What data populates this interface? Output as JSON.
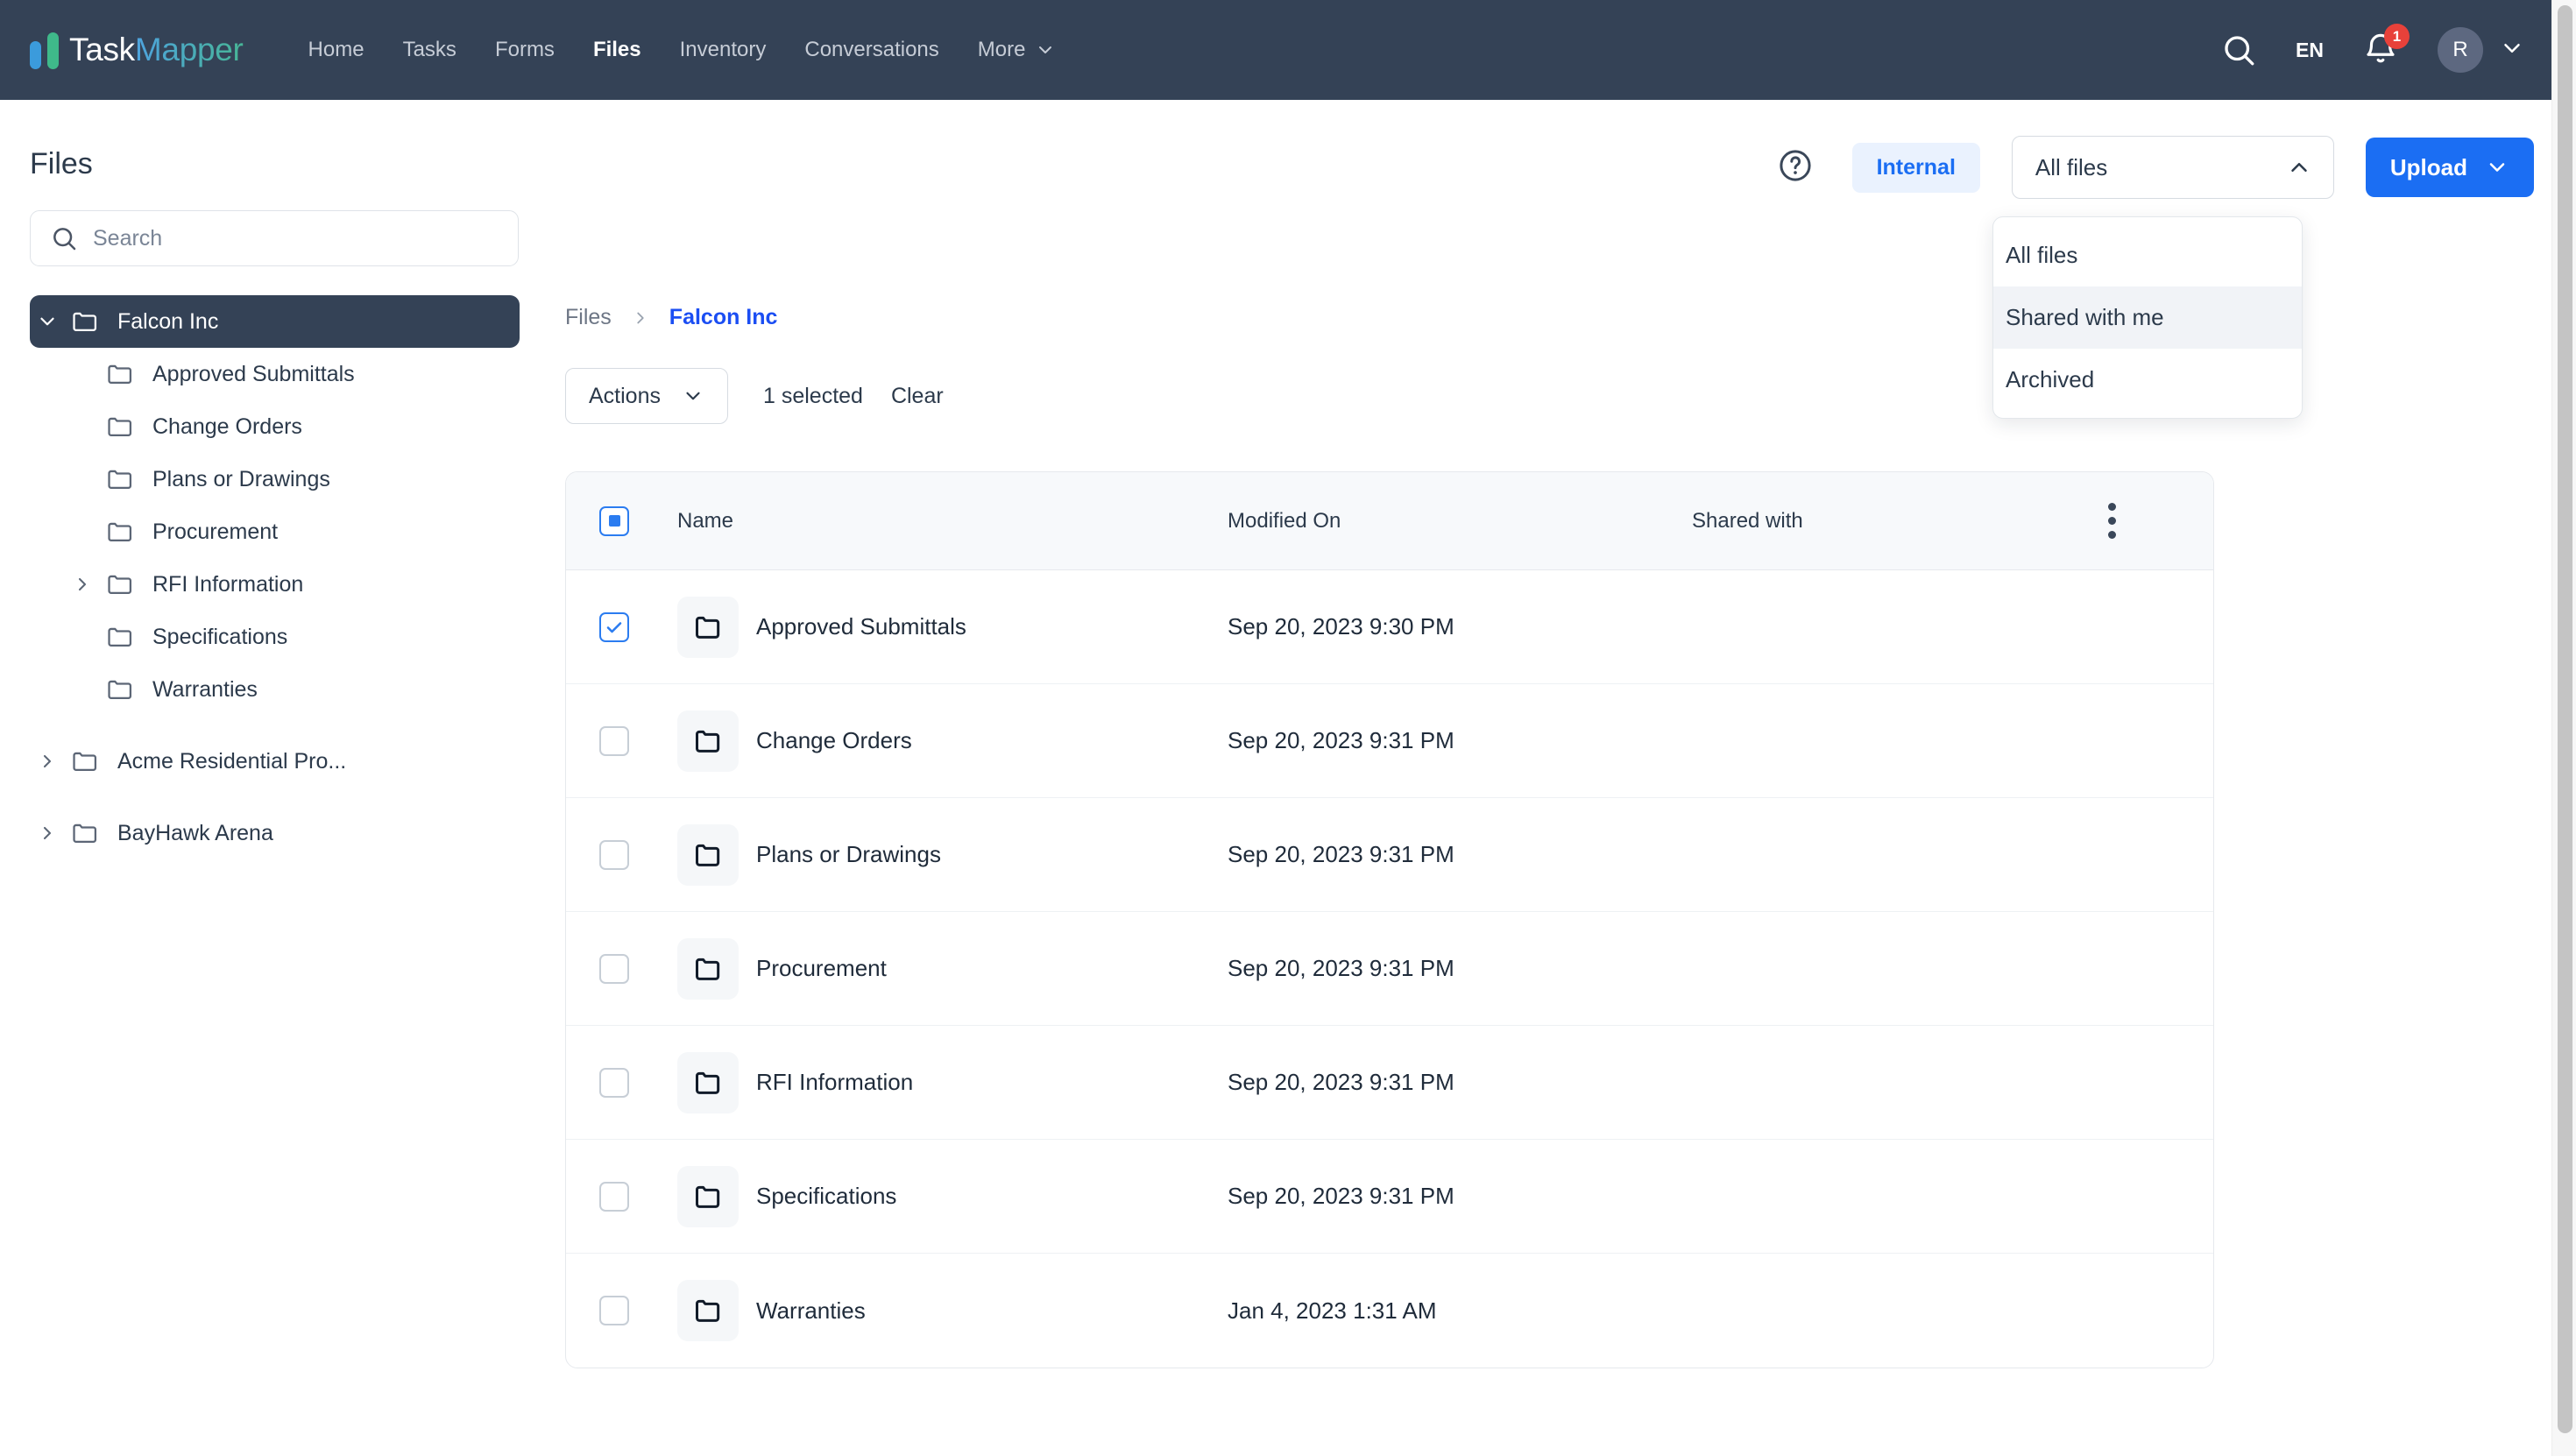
{
  "brand": {
    "name_first": "Task",
    "name_second": "Mapper",
    "bar_blue": "#3b9bdc",
    "bar_green": "#3fb98a"
  },
  "topnav": {
    "links": [
      {
        "label": "Home",
        "active": false
      },
      {
        "label": "Tasks",
        "active": false
      },
      {
        "label": "Forms",
        "active": false
      },
      {
        "label": "Files",
        "active": true
      },
      {
        "label": "Inventory",
        "active": false
      },
      {
        "label": "Conversations",
        "active": false
      }
    ],
    "more_label": "More",
    "search_icon": "search-icon",
    "language": "EN",
    "bell_icon": "bell-icon",
    "notification_count": "1",
    "avatar_initial": "R",
    "caret_icon": "chevron-down-icon"
  },
  "page": {
    "title": "Files"
  },
  "header_actions": {
    "help_icon": "question-circle-icon",
    "internal_chip": "Internal",
    "filter_select": {
      "value": "All files",
      "caret": "chevron-up-icon",
      "options": [
        "All files",
        "Shared with me",
        "Archived"
      ],
      "hovered_option": "Shared with me"
    },
    "upload_button": "Upload",
    "upload_caret": "chevron-down-icon"
  },
  "sidebar": {
    "search_placeholder": "Search",
    "search_value": "",
    "tree": [
      {
        "label": "Falcon Inc",
        "level": 0,
        "expandable": true,
        "expanded": true,
        "active": true
      },
      {
        "label": "Approved Submittals",
        "level": 1,
        "expandable": false,
        "expanded": false,
        "active": false
      },
      {
        "label": "Change Orders",
        "level": 1,
        "expandable": false,
        "expanded": false,
        "active": false
      },
      {
        "label": "Plans or Drawings",
        "level": 1,
        "expandable": false,
        "expanded": false,
        "active": false
      },
      {
        "label": "Procurement",
        "level": 1,
        "expandable": false,
        "expanded": false,
        "active": false
      },
      {
        "label": "RFI Information",
        "level": 1,
        "expandable": true,
        "expanded": false,
        "active": false
      },
      {
        "label": "Specifications",
        "level": 1,
        "expandable": false,
        "expanded": false,
        "active": false
      },
      {
        "label": "Warranties",
        "level": 1,
        "expandable": false,
        "expanded": false,
        "active": false
      },
      {
        "label": "Acme Residential Pro...",
        "level": 0,
        "expandable": true,
        "expanded": false,
        "active": false
      },
      {
        "label": "BayHawk Arena",
        "level": 0,
        "expandable": true,
        "expanded": false,
        "active": false
      }
    ]
  },
  "breadcrumb": {
    "root": "Files",
    "separator": "›",
    "current": "Falcon Inc"
  },
  "toolbar": {
    "actions_label": "Actions",
    "actions_caret": "chevron-down-icon",
    "selected_text": "1 selected",
    "clear_label": "Clear"
  },
  "table": {
    "columns": [
      "Name",
      "Modified On",
      "Shared with"
    ],
    "header_checkbox_state": "indeterminate",
    "kebab_icon": "more-vertical-icon",
    "rows": [
      {
        "name": "Approved Submittals",
        "modified": "Sep 20, 2023 9:30 PM",
        "shared": "",
        "checked": true
      },
      {
        "name": "Change Orders",
        "modified": "Sep 20, 2023 9:31 PM",
        "shared": "",
        "checked": false
      },
      {
        "name": "Plans or Drawings",
        "modified": "Sep 20, 2023 9:31 PM",
        "shared": "",
        "checked": false
      },
      {
        "name": "Procurement",
        "modified": "Sep 20, 2023 9:31 PM",
        "shared": "",
        "checked": false
      },
      {
        "name": "RFI Information",
        "modified": "Sep 20, 2023 9:31 PM",
        "shared": "",
        "checked": false
      },
      {
        "name": "Specifications",
        "modified": "Sep 20, 2023 9:31 PM",
        "shared": "",
        "checked": false
      },
      {
        "name": "Warranties",
        "modified": "Jan 4, 2023 1:31 AM",
        "shared": "",
        "checked": false
      }
    ]
  },
  "colors": {
    "nav_bg": "#344256",
    "accent_blue": "#1b6ef3",
    "link_blue": "#1b4ef3",
    "badge_red": "#e8413a",
    "text_dark": "#2c3a4b"
  }
}
